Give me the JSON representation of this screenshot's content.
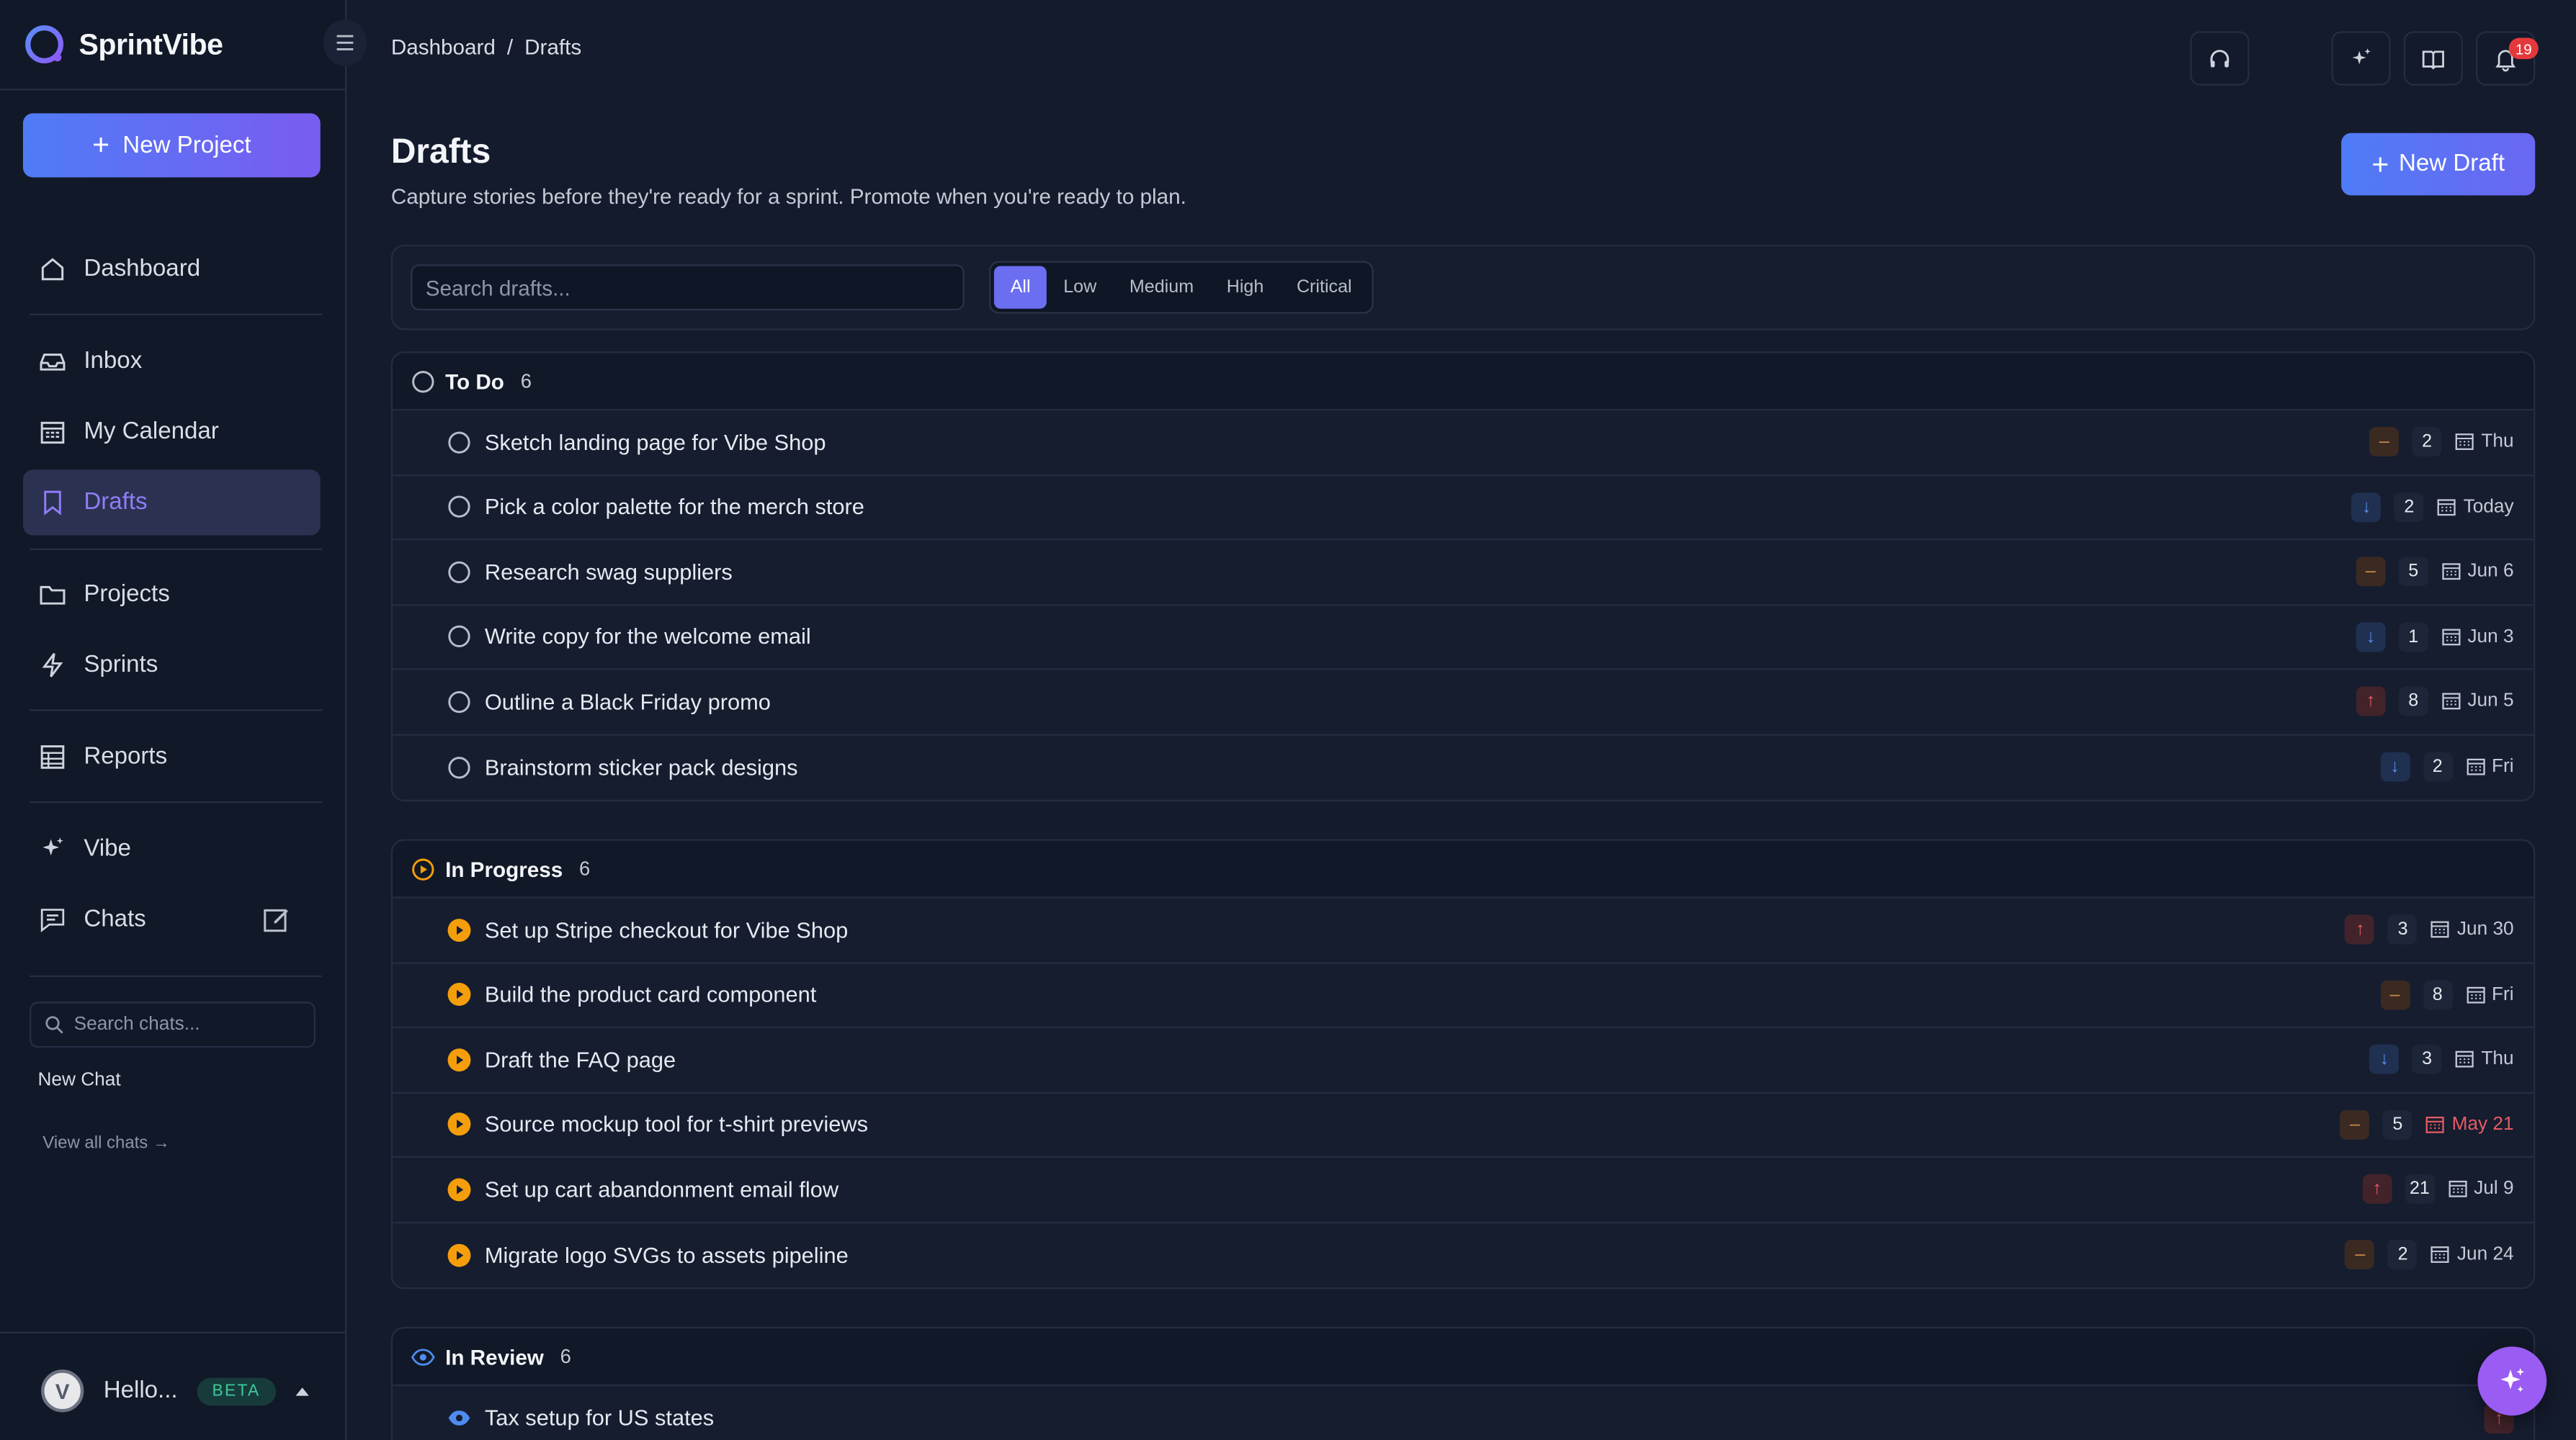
{
  "app": {
    "name": "SprintVibe"
  },
  "sidebar": {
    "new_project_label": "New Project",
    "items": [
      {
        "label": "Dashboard",
        "icon": "home-icon"
      },
      {
        "label": "Inbox",
        "icon": "inbox-icon"
      },
      {
        "label": "My Calendar",
        "icon": "calendar-icon"
      },
      {
        "label": "Drafts",
        "icon": "bookmark-icon",
        "active": true
      },
      {
        "label": "Projects",
        "icon": "folder-icon"
      },
      {
        "label": "Sprints",
        "icon": "bolt-icon"
      },
      {
        "label": "Reports",
        "icon": "table-icon"
      },
      {
        "label": "Vibe",
        "icon": "sparkle-icon"
      },
      {
        "label": "Chats",
        "icon": "chat-icon"
      }
    ],
    "search_chats_placeholder": "Search chats...",
    "new_chat_label": "New Chat",
    "view_all_chats_label": "View all chats",
    "user": {
      "name": "Hello...",
      "avatar_letter": "V",
      "badge": "BETA"
    }
  },
  "topbar": {
    "breadcrumb": [
      "Dashboard",
      "/",
      "Drafts"
    ],
    "notification_count": "19"
  },
  "header": {
    "title": "Drafts",
    "subtitle": "Capture stories before they're ready for a sprint. Promote when you're ready to plan.",
    "new_draft_label": "New Draft"
  },
  "filters": {
    "search_placeholder": "Search drafts...",
    "priorities": [
      "All",
      "Low",
      "Medium",
      "High",
      "Critical"
    ],
    "selected": "All"
  },
  "groups": [
    {
      "title": "To Do",
      "count": "6",
      "rows": [
        {
          "title": "Sketch landing page for Vibe Shop",
          "priority": "medium",
          "points": "2",
          "due": "Thu"
        },
        {
          "title": "Pick a color palette for the merch store",
          "priority": "low",
          "points": "2",
          "due": "Today"
        },
        {
          "title": "Research swag suppliers",
          "priority": "medium",
          "points": "5",
          "due": "Jun 6"
        },
        {
          "title": "Write copy for the welcome email",
          "priority": "low",
          "points": "1",
          "due": "Jun 3"
        },
        {
          "title": "Outline a Black Friday promo",
          "priority": "high",
          "points": "8",
          "due": "Jun 5"
        },
        {
          "title": "Brainstorm sticker pack designs",
          "priority": "low",
          "points": "2",
          "due": "Fri"
        }
      ]
    },
    {
      "title": "In Progress",
      "count": "6",
      "rows": [
        {
          "title": "Set up Stripe checkout for Vibe Shop",
          "priority": "high",
          "points": "3",
          "due": "Jun 30"
        },
        {
          "title": "Build the product card component",
          "priority": "medium",
          "points": "8",
          "due": "Fri"
        },
        {
          "title": "Draft the FAQ page",
          "priority": "low",
          "points": "3",
          "due": "Thu"
        },
        {
          "title": "Source mockup tool for t-shirt previews",
          "priority": "medium",
          "points": "5",
          "due": "May 21",
          "overdue": true
        },
        {
          "title": "Set up cart abandonment email flow",
          "priority": "high",
          "points": "21",
          "due": "Jul 9"
        },
        {
          "title": "Migrate logo SVGs to assets pipeline",
          "priority": "medium",
          "points": "2",
          "due": "Jun 24"
        }
      ]
    },
    {
      "title": "In Review",
      "count": "6",
      "rows": [
        {
          "title": "Tax setup for US states",
          "priority": "high",
          "points": "",
          "due": ""
        }
      ]
    }
  ],
  "colors": {
    "accent": "#6b6ef0",
    "brand_gradient_start": "#4f7cf6",
    "brand_gradient_end": "#7a5cf0",
    "priority_high": "#e65a62",
    "priority_medium": "#d08a4a",
    "priority_low": "#5b8cf0",
    "in_progress": "#f59e0b",
    "in_review": "#4f8cf0"
  }
}
